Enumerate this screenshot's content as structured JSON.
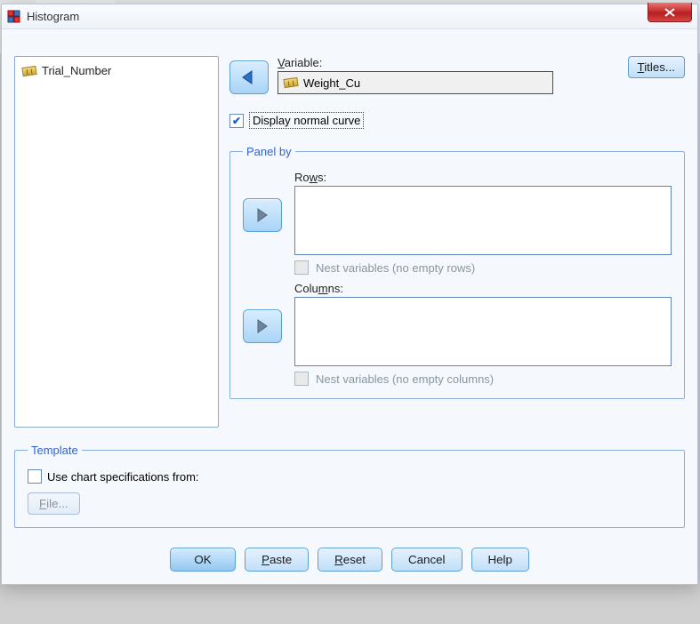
{
  "window": {
    "title": "Histogram",
    "close_tooltip": "Close"
  },
  "source_vars": [
    "Trial_Number"
  ],
  "variable": {
    "label_prefix": "V",
    "label_rest": "ariable:",
    "selected": "Weight_Cu"
  },
  "display_curve": {
    "checked": true,
    "label_prefix": "D",
    "label_rest": "isplay normal curve"
  },
  "panel": {
    "legend": "Panel by",
    "rows": {
      "label_prefix": "Ro",
      "label_u": "w",
      "label_suffix": "s:",
      "nest": "Nest variables (no empty rows)"
    },
    "columns": {
      "label_prefix": "Colu",
      "label_u": "m",
      "label_suffix": "ns:",
      "nest": "Nest variables (no empty columns)"
    }
  },
  "template": {
    "legend": "Template",
    "use_label_u": "U",
    "use_label_rest": "se chart specifications from:",
    "file_btn_u": "F",
    "file_btn_rest": "ile..."
  },
  "titles_btn": {
    "u": "T",
    "rest": "itles..."
  },
  "buttons": {
    "ok": "OK",
    "paste_u": "P",
    "paste_rest": "aste",
    "reset_u": "R",
    "reset_rest": "eset",
    "cancel": "Cancel",
    "help": "Help"
  }
}
